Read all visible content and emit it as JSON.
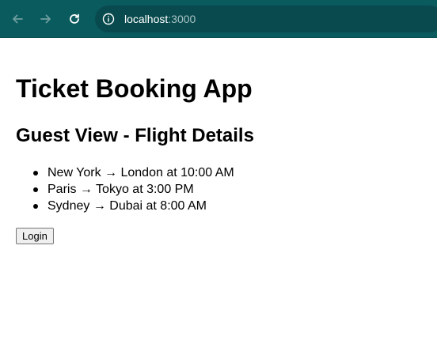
{
  "browser": {
    "url_host": "localhost",
    "url_port": ":3000",
    "toolbar_color": "#0a5b5e",
    "icons": [
      "back-arrow-icon",
      "forward-arrow-icon",
      "reload-icon",
      "site-info-icon"
    ]
  },
  "page": {
    "title": "Ticket Booking App",
    "subtitle": "Guest View - Flight Details",
    "flights": [
      "New York → London at 10:00 AM",
      "Paris → Tokyo at 3:00 PM",
      "Sydney → Dubai at 8:00 AM"
    ],
    "login_label": "Login"
  }
}
